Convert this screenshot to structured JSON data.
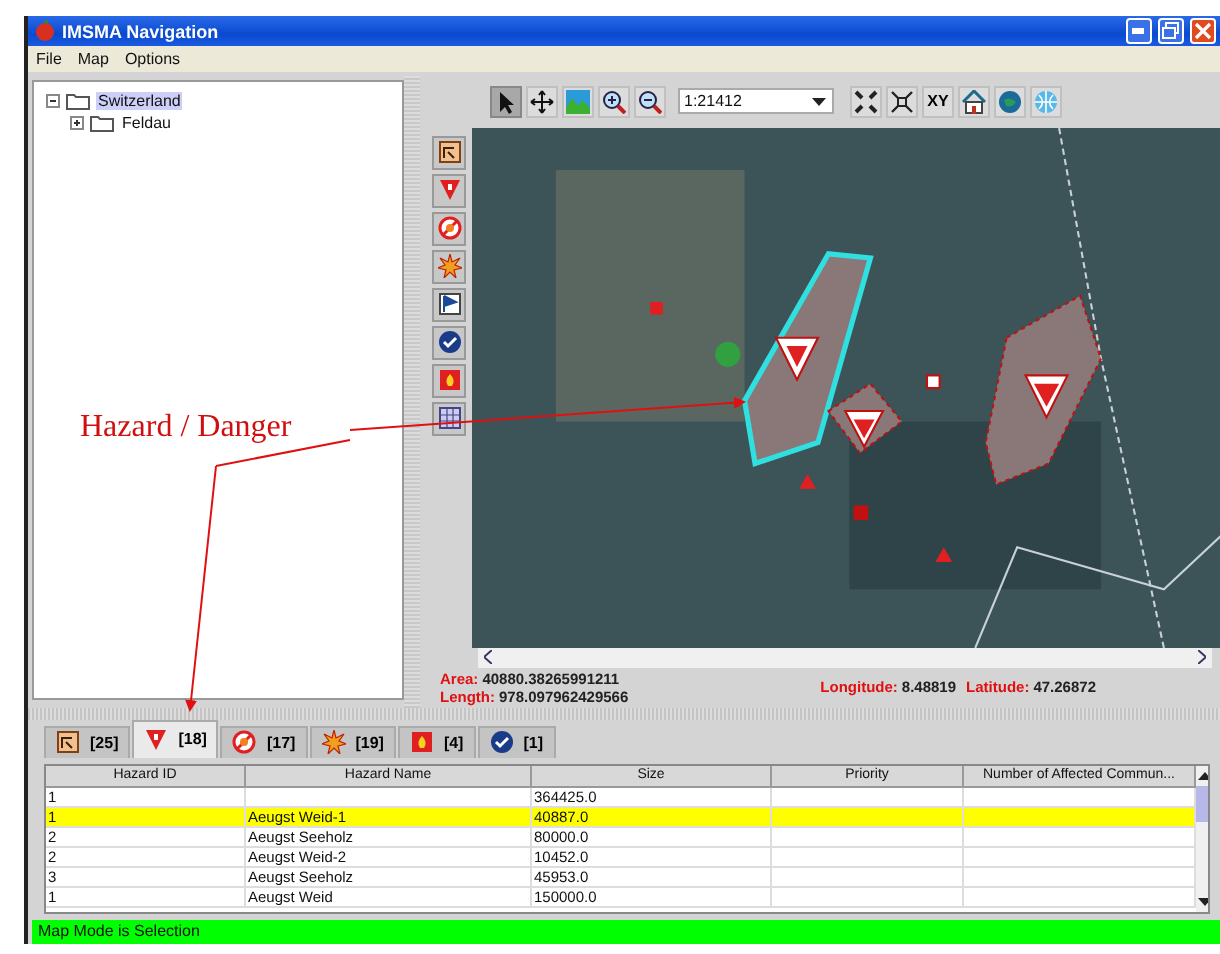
{
  "window": {
    "title": "IMSMA Navigation"
  },
  "menu": [
    "File",
    "Map",
    "Options"
  ],
  "tree": [
    {
      "label": "Switzerland",
      "selected": true,
      "expanded": true,
      "children": [
        {
          "label": "Feldau",
          "selected": false,
          "expanded": false
        }
      ]
    }
  ],
  "map_toolbar": {
    "tools": [
      {
        "kind": "select",
        "selected": true
      },
      {
        "kind": "pan",
        "selected": false
      },
      {
        "kind": "layers",
        "selected": false
      },
      {
        "kind": "zoom-in",
        "selected": false
      },
      {
        "kind": "zoom-out",
        "selected": false
      }
    ],
    "scale": "1:21412",
    "tools_after": [
      {
        "kind": "full-extent",
        "selected": false
      },
      {
        "kind": "zoom-extent",
        "selected": false
      },
      {
        "kind": "xy",
        "label": "XY",
        "selected": false
      },
      {
        "kind": "home",
        "selected": false
      },
      {
        "kind": "globe",
        "selected": false
      },
      {
        "kind": "globe-grid",
        "selected": false
      }
    ]
  },
  "layer_tools": [
    {
      "kind": "minefield"
    },
    {
      "kind": "hazard"
    },
    {
      "kind": "no-entry"
    },
    {
      "kind": "explosion"
    },
    {
      "kind": "flag"
    },
    {
      "kind": "check"
    },
    {
      "kind": "fire"
    },
    {
      "kind": "grid"
    }
  ],
  "map_info": {
    "area_label": "Area:",
    "area_value": "40880.38265991211",
    "length_label": "Length:",
    "length_value": "978.097962429566",
    "longitude_label": "Longitude:",
    "longitude_value": "8.48819",
    "latitude_label": "Latitude:",
    "latitude_value": "47.26872"
  },
  "annotation": "Hazard / Danger",
  "tabs": [
    {
      "kind": "minefield",
      "count": "[25]",
      "selected": false
    },
    {
      "kind": "hazard",
      "count": "[18]",
      "selected": true
    },
    {
      "kind": "no-entry",
      "count": "[17]",
      "selected": false
    },
    {
      "kind": "explosion",
      "count": "[19]",
      "selected": false
    },
    {
      "kind": "fire",
      "count": "[4]",
      "selected": false
    },
    {
      "kind": "check",
      "count": "[1]",
      "selected": false
    }
  ],
  "table": {
    "columns": [
      "Hazard ID",
      "Hazard Name",
      "Size",
      "Priority",
      "Number of Affected Commun..."
    ],
    "rows": [
      {
        "cells": [
          "1",
          "",
          "364425.0",
          "",
          ""
        ],
        "selected": false
      },
      {
        "cells": [
          "1",
          "Aeugst Weid-1",
          "40887.0",
          "",
          ""
        ],
        "selected": true
      },
      {
        "cells": [
          "2",
          "Aeugst Seeholz",
          "80000.0",
          "",
          ""
        ],
        "selected": false
      },
      {
        "cells": [
          "2",
          "Aeugst Weid-2",
          "10452.0",
          "",
          ""
        ],
        "selected": false
      },
      {
        "cells": [
          "3",
          "Aeugst Seeholz",
          "45953.0",
          "",
          ""
        ],
        "selected": false
      },
      {
        "cells": [
          "1",
          "Aeugst Weid",
          "150000.0",
          "",
          ""
        ],
        "selected": false
      }
    ]
  },
  "status_bar": "Map Mode is Selection"
}
